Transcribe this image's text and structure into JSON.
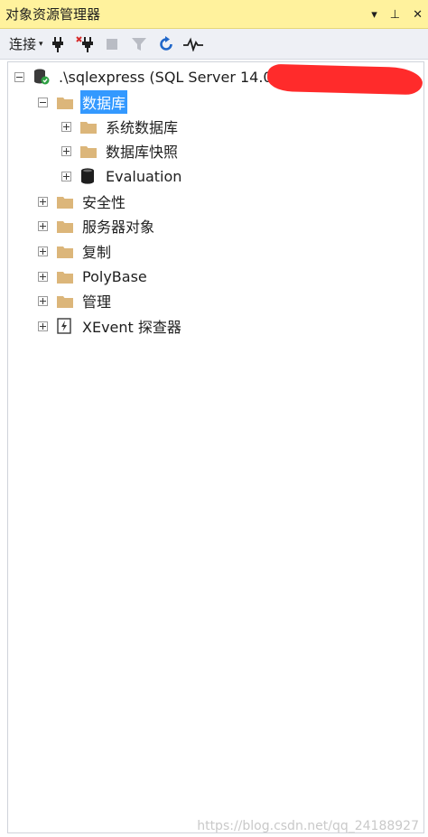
{
  "window": {
    "title": "对象资源管理器",
    "controls": [
      "▾",
      "⊥",
      "✕"
    ]
  },
  "toolbar": {
    "connect_label": "连接",
    "connect_caret": "▾",
    "icons": [
      "connect-plug-icon",
      "disconnect-plug-icon",
      "stop-icon",
      "filter-icon",
      "refresh-icon",
      "activity-monitor-icon"
    ]
  },
  "tree": {
    "server": ".\\sqlexpress (SQL Server 14.0",
    "databases": "数据库",
    "system_databases": "系统数据库",
    "database_snapshots": "数据库快照",
    "evaluation": "Evaluation",
    "security": "安全性",
    "server_objects": "服务器对象",
    "replication": "复制",
    "polybase": "PolyBase",
    "management": "管理",
    "xevent_profiler": "XEvent 探查器"
  },
  "colors": {
    "title_bg": "#fff29d",
    "toolbar_bg": "#eef0f5",
    "selection": "#3399ff",
    "folder": "#dcb67a",
    "redaction": "#ff2b2b"
  },
  "watermark": "https://blog.csdn.net/qq_24188927"
}
